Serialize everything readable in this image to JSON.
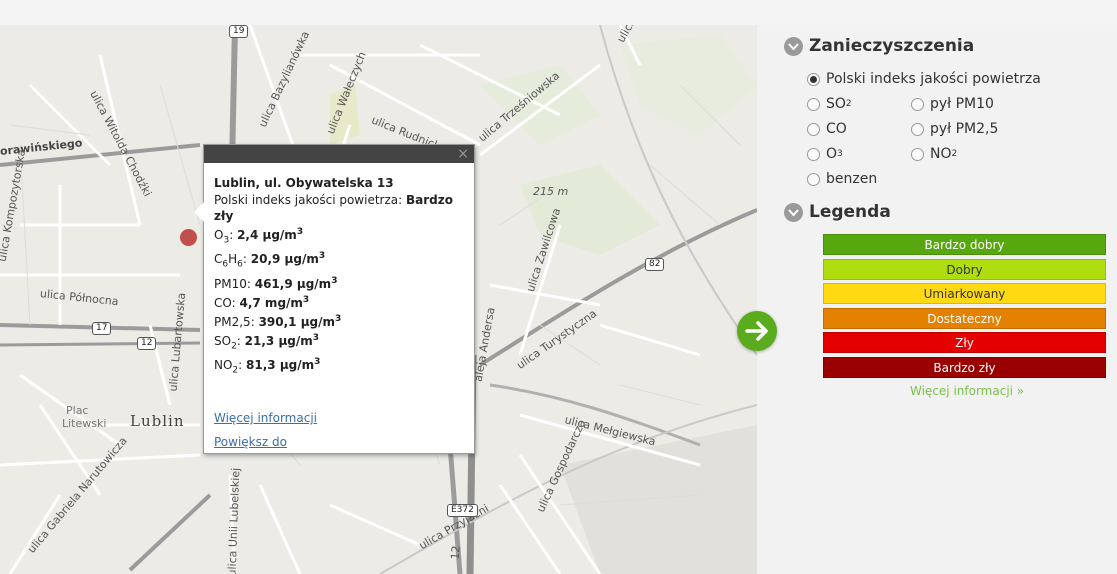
{
  "map": {
    "city_label": "Lublin",
    "street_labels": [
      "ulica Bazylianówka",
      "ulica Rudnicka",
      "ulica Trześniowska",
      "ulica Wałeczych",
      "ulica Witolda Chodźki",
      "orawińskiego",
      "ulica Północna",
      "ulica Lubartowska",
      "ulica Zawilcowa",
      "ulica Turystyczna",
      "ulica Mełgiewska",
      "ulica Gospodarcza",
      "ulica Gabriela Narutowicza",
      "ulica Unii Lubelskiej",
      "ulica Przyjaźni",
      "aleja Andersa",
      "ulica Kompozytorska",
      "ulica"
    ],
    "place_labels": [
      "Plac",
      "Litewski"
    ],
    "spot_height": "215 m",
    "road_shields": [
      "19",
      "17",
      "12",
      "82",
      "E372",
      "12"
    ]
  },
  "popup": {
    "station": "Lublin, ul. Obywatelska 13",
    "index_label": "Polski indeks jakości powietrza:",
    "index_value": "Bardzo zły",
    "measurements": [
      {
        "label_main": "O",
        "label_sub": "3",
        "label_rest": ":",
        "value": "2,4 µg/m",
        "unit_sup": "3"
      },
      {
        "label_main": "C",
        "label_sub": "6",
        "label_mid": "H",
        "label_sub2": "6",
        "label_rest": ":",
        "value": "20,9 µg/m",
        "unit_sup": "3"
      },
      {
        "label_main": "PM10",
        "label_rest": ":",
        "value": "461,9 µg/m",
        "unit_sup": "3"
      },
      {
        "label_main": "CO",
        "label_rest": ":",
        "value": "4,7 mg/m",
        "unit_sup": "3"
      },
      {
        "label_main": "PM2,5",
        "label_rest": ":",
        "value": "390,1 µg/m",
        "unit_sup": "3"
      },
      {
        "label_main": "SO",
        "label_sub": "2",
        "label_rest": ":",
        "value": "21,3 µg/m",
        "unit_sup": "3"
      },
      {
        "label_main": "NO",
        "label_sub": "2",
        "label_rest": ":",
        "value": "81,3 µg/m",
        "unit_sup": "3"
      }
    ],
    "link_more": "Więcej informacji",
    "link_zoom": "Powiększ do",
    "close_glyph": "×"
  },
  "panel": {
    "pollutants_title": "Zanieczyszczenia",
    "options": {
      "index": "Polski indeks jakości powietrza",
      "so2_main": "SO",
      "so2_sub": "2",
      "pm10": "pył PM10",
      "co": "CO",
      "pm25": "pył PM2,5",
      "o3_main": "O",
      "o3_sub": "3",
      "no2_main": "NO",
      "no2_sub": "2",
      "benzen": "benzen"
    },
    "selected_option": "index",
    "legend_title": "Legenda",
    "legend": [
      {
        "label": "Bardzo dobry",
        "color": "#57a70e"
      },
      {
        "label": "Dobry",
        "color": "#b0dd10"
      },
      {
        "label": "Umiarkowany",
        "color": "#ffd912"
      },
      {
        "label": "Dostateczny",
        "color": "#e58100"
      },
      {
        "label": "Zły",
        "color": "#e50000"
      },
      {
        "label": "Bardzo zły",
        "color": "#990000"
      }
    ],
    "legend_more": "Więcej informacji »"
  },
  "colors": {
    "accent_green": "#5aab1d",
    "link_blue": "#3a6fa8"
  }
}
